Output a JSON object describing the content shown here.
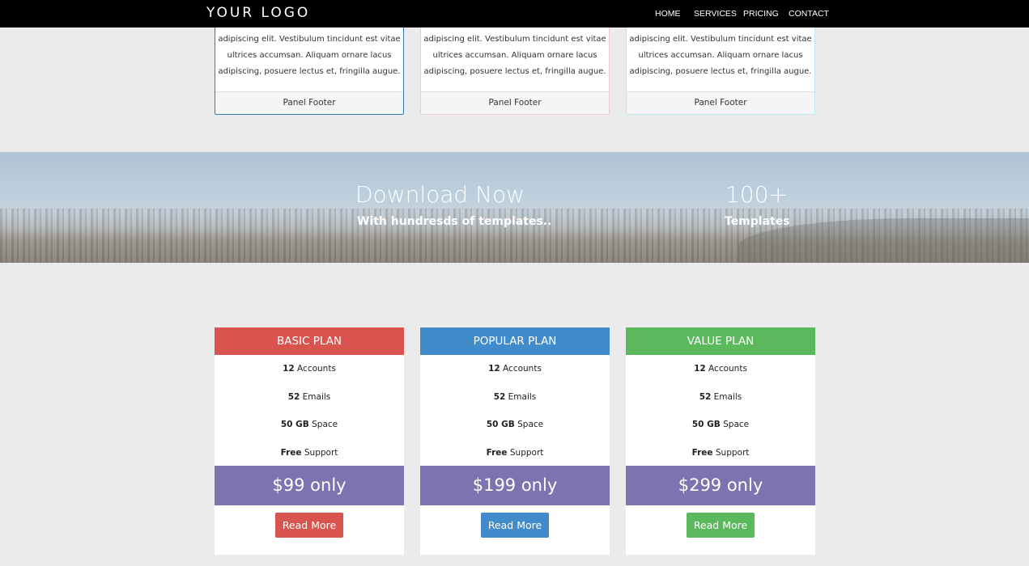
{
  "navbar": {
    "logo": "YOUR LOGO",
    "items": [
      {
        "label": "HOME"
      },
      {
        "label": "SERVICES"
      },
      {
        "label": "PRICING"
      },
      {
        "label": "CONTACT"
      }
    ]
  },
  "panels": [
    {
      "lines": [
        "adipiscing elit. Vestibulum tincidunt est vitae",
        "ultrices accumsan. Aliquam ornare lacus",
        "adipiscing, posuere lectus et, fringilla augue."
      ],
      "footer": "Panel Footer",
      "border_color": "#337ab7"
    },
    {
      "lines": [
        "adipiscing elit. Vestibulum tincidunt est vitae",
        "ultrices accumsan. Aliquam ornare lacus",
        "adipiscing, posuere lectus et, fringilla augue."
      ],
      "footer": "Panel Footer",
      "border_color": "#ebccd1"
    },
    {
      "lines": [
        "adipiscing elit. Vestibulum tincidunt est vitae",
        "ultrices accumsan. Aliquam ornare lacus",
        "adipiscing, posuere lectus et, fringilla augue."
      ],
      "footer": "Panel Footer",
      "border_color": "#bce8f1"
    }
  ],
  "banner": {
    "left_title": "Download Now",
    "left_subtitle": "With hundresds of templates..",
    "right_title": "100+",
    "right_subtitle": "Templates"
  },
  "plans": [
    {
      "name": "BASIC PLAN",
      "color": "#d9534f",
      "features": [
        [
          "12",
          "Accounts"
        ],
        [
          "52",
          "Emails"
        ],
        [
          "50 GB",
          "Space"
        ],
        [
          "Free",
          "Support"
        ]
      ],
      "price": "$99 only",
      "button": "Read More"
    },
    {
      "name": "POPULAR PLAN",
      "color": "#428bca",
      "features": [
        [
          "12",
          "Accounts"
        ],
        [
          "52",
          "Emails"
        ],
        [
          "50 GB",
          "Space"
        ],
        [
          "Free",
          "Support"
        ]
      ],
      "price": "$199 only",
      "button": "Read More"
    },
    {
      "name": "VALUE PLAN",
      "color": "#5cb85c",
      "features": [
        [
          "12",
          "Accounts"
        ],
        [
          "52",
          "Emails"
        ],
        [
          "50 GB",
          "Space"
        ],
        [
          "Free",
          "Support"
        ]
      ],
      "price": "$299 only",
      "button": "Read More"
    }
  ],
  "colors": {
    "price_band": "#7f72b1",
    "navbar": "#000000",
    "page_bg": "#ebebeb"
  }
}
